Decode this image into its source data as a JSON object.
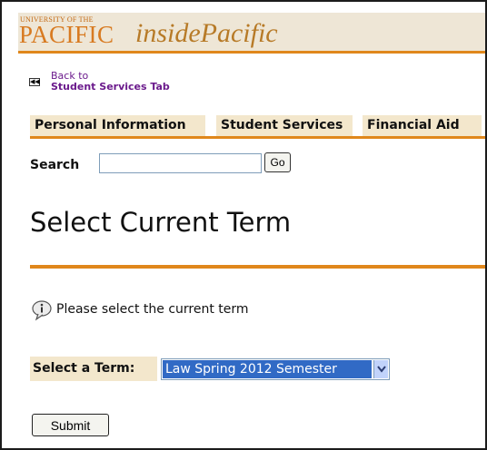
{
  "header": {
    "logo_university": "UNIVERSITY OF THE",
    "logo_pacific": "PACIFIC",
    "portal_name": "insidePacific"
  },
  "back_link": {
    "line1": "Back to",
    "line2": "Student Services Tab",
    "icon": "back-arrows-icon"
  },
  "tabs": [
    {
      "label": "Personal Information"
    },
    {
      "label": "Student Services"
    },
    {
      "label": "Financial Aid"
    }
  ],
  "search": {
    "label": "Search",
    "value": "",
    "button_label": "Go"
  },
  "page": {
    "title": "Select Current Term",
    "info_icon": "info-speech-icon",
    "info_text": "Please select the current term"
  },
  "term_select": {
    "label": "Select a Term:",
    "selected": "Law Spring 2012 Semester"
  },
  "submit_label": "Submit",
  "colors": {
    "accent_orange": "#e0871b",
    "tab_background": "#f3e7cc",
    "banner_background": "#eee6d6",
    "link_purple": "#6b1a8c",
    "selection_blue": "#316ac5"
  }
}
